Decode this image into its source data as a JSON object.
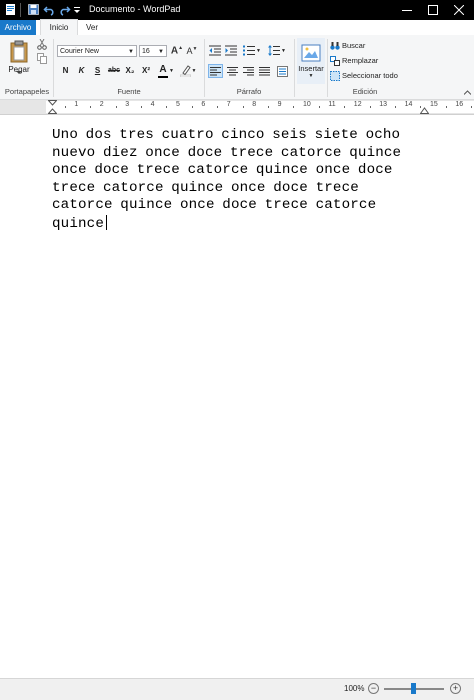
{
  "window": {
    "title": "Documento - WordPad",
    "minimize_icon": "minimize-icon",
    "maximize_icon": "maximize-icon",
    "close_icon": "close-icon"
  },
  "quick_access": [
    "wordpad-app-icon",
    "save-icon",
    "undo-icon",
    "redo-icon",
    "customize-dropdown-icon"
  ],
  "tabs": {
    "file": "Archivo",
    "home": "Inicio",
    "view": "Ver"
  },
  "clipboard": {
    "paste": "Pegar",
    "group": "Portapapeles"
  },
  "font": {
    "family": "Courier New",
    "size": "16",
    "group": "Fuente",
    "bold": "N",
    "italic": "K",
    "underline": "S",
    "strike": "abc",
    "subscript": "X₂",
    "superscript": "X²",
    "color_letter": "A"
  },
  "paragraph": {
    "group": "Párrafo"
  },
  "insert": {
    "label": "Insertar"
  },
  "editing": {
    "find": "Buscar",
    "replace": "Remplazar",
    "select_all": "Seleccionar todo",
    "group": "Edición"
  },
  "ruler": {
    "numbers": [
      "1",
      "2",
      "3",
      "4",
      "5",
      "6",
      "7",
      "8",
      "9",
      "10",
      "11",
      "12",
      "13",
      "14",
      "15",
      "16"
    ]
  },
  "document": {
    "text": "Uno dos tres cuatro cinco seis siete ocho nuevo diez once doce trece catorce quince once doce trece catorce quince once doce trece catorce quince once doce trece catorce quince once doce trece catorce quince"
  },
  "status": {
    "zoom": "100%",
    "zoom_level_percent": 100
  },
  "colors": {
    "accent": "#1979ca",
    "titlebar": "#000000",
    "ribbon": "#f5f6f7"
  }
}
